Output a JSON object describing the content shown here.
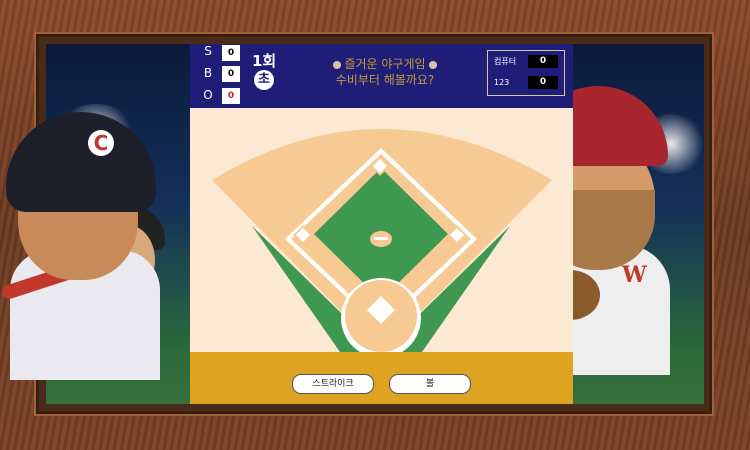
{
  "count": {
    "strike": {
      "label": "S",
      "value": "0"
    },
    "ball": {
      "label": "B",
      "value": "0"
    },
    "out": {
      "label": "O",
      "value": "0"
    }
  },
  "inning": {
    "number": "1회",
    "half": "초"
  },
  "message": {
    "line1": "즐거운 야구게임",
    "line2": "수비부터 해볼까요?"
  },
  "scoreboard": [
    {
      "name": "컴퓨터",
      "score": "0"
    },
    {
      "name": "123",
      "score": "0"
    }
  ],
  "buttons": {
    "strike": "스트라이크",
    "ball": "볼"
  },
  "colors": {
    "hud_bg": "#1e1e78",
    "field_green": "#3f9850",
    "dirt": "#f7c993",
    "bottom_bar": "#dfa322",
    "out_value": "#d02020"
  },
  "icons": {
    "message_icon": "baseball-icon"
  }
}
